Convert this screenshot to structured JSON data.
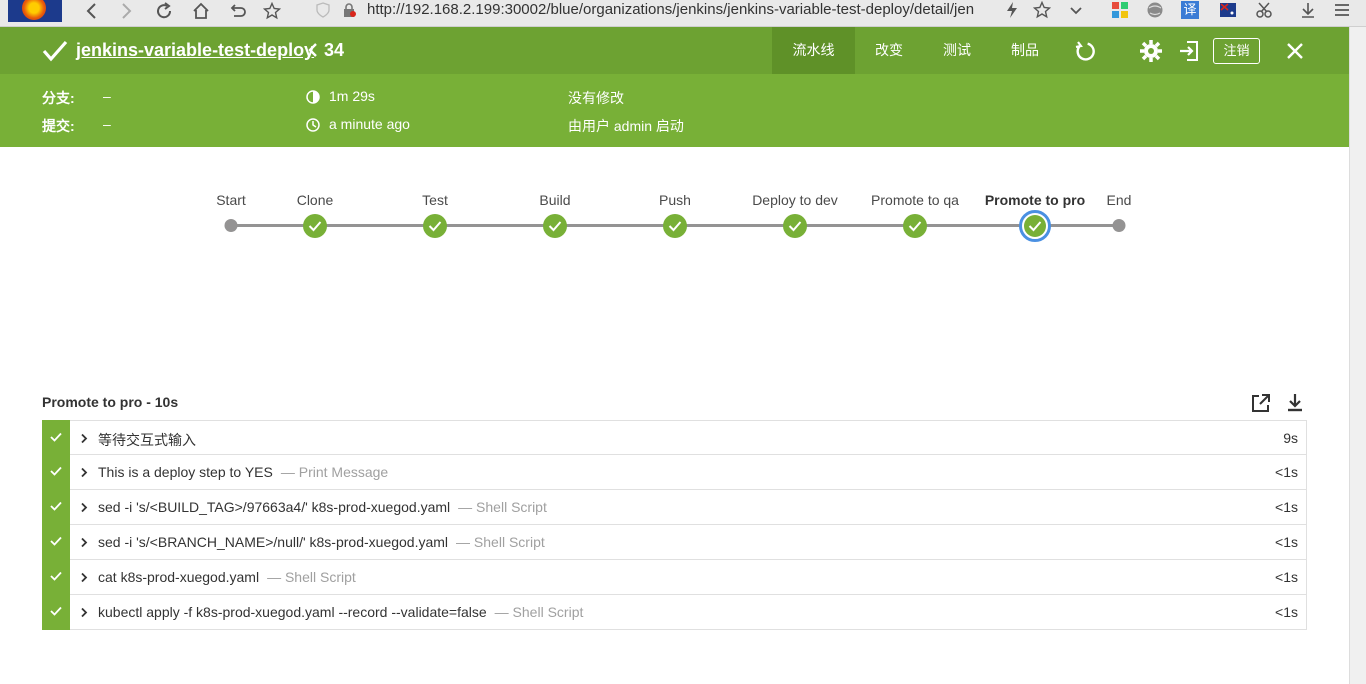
{
  "browser": {
    "url": "http://192.168.2.199:30002/blue/organizations/jenkins/jenkins-variable-test-deploy/detail/jen",
    "translate_label": "译"
  },
  "header": {
    "job_name": "jenkins-variable-test-deploy",
    "run_number": "34",
    "tabs": [
      {
        "label": "流水线",
        "active": true
      },
      {
        "label": "改变",
        "active": false
      },
      {
        "label": "测试",
        "active": false
      },
      {
        "label": "制品",
        "active": false
      }
    ],
    "logout_label": "注销",
    "meta": {
      "branch_label": "分支:",
      "branch_value": "–",
      "commit_label": "提交:",
      "commit_value": "–",
      "duration": "1m 29s",
      "time_ago": "a minute ago",
      "changes": "没有修改",
      "started_by": "由用户 admin 启动"
    },
    "colors": {
      "header_bg": "#78b037",
      "accent_blue": "#4a90e2",
      "success": "#78b037"
    }
  },
  "pipeline": {
    "stages": [
      {
        "label": "Start",
        "kind": "terminal"
      },
      {
        "label": "Clone",
        "kind": "success"
      },
      {
        "label": "Test",
        "kind": "success"
      },
      {
        "label": "Build",
        "kind": "success"
      },
      {
        "label": "Push",
        "kind": "success"
      },
      {
        "label": "Deploy to dev",
        "kind": "success"
      },
      {
        "label": "Promote to qa",
        "kind": "success"
      },
      {
        "label": "Promote to pro",
        "kind": "selected"
      },
      {
        "label": "End",
        "kind": "terminal"
      }
    ]
  },
  "steps": {
    "title": "Promote to pro - 10s",
    "items": [
      {
        "text": "等待交互式输入",
        "type": "",
        "duration": "9s"
      },
      {
        "text": "This is a deploy step to YES",
        "type": "— Print Message",
        "duration": "<1s"
      },
      {
        "text": "sed -i 's/<BUILD_TAG>/97663a4/' k8s-prod-xuegod.yaml",
        "type": "— Shell Script",
        "duration": "<1s"
      },
      {
        "text": "sed -i 's/<BRANCH_NAME>/null/' k8s-prod-xuegod.yaml",
        "type": "— Shell Script",
        "duration": "<1s"
      },
      {
        "text": "cat k8s-prod-xuegod.yaml",
        "type": "— Shell Script",
        "duration": "<1s"
      },
      {
        "text": "kubectl apply -f k8s-prod-xuegod.yaml --record --validate=false",
        "type": "— Shell Script",
        "duration": "<1s"
      }
    ]
  }
}
